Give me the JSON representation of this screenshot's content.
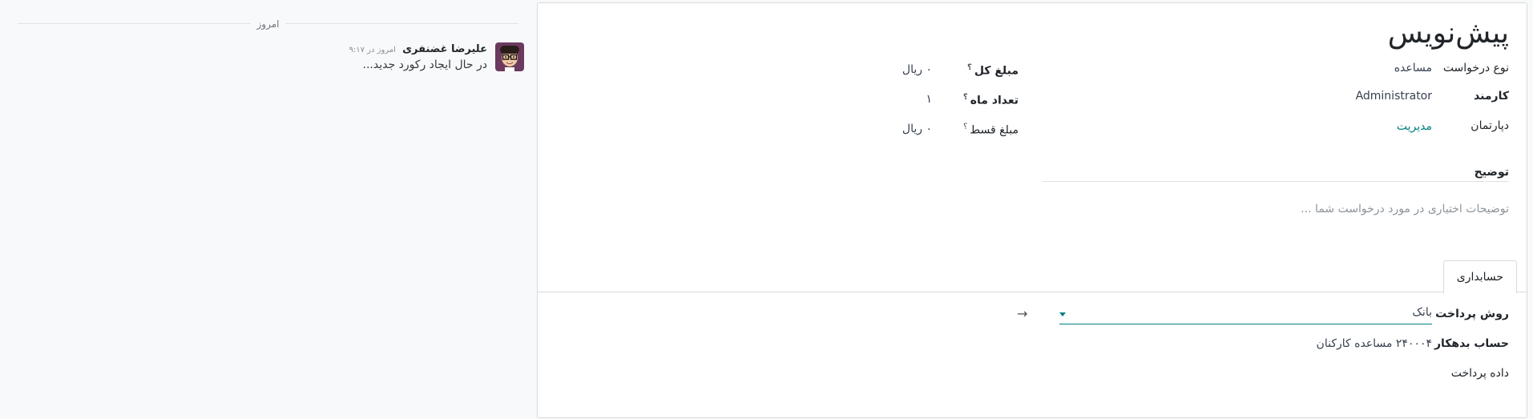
{
  "chatter": {
    "date_separator": "امروز",
    "message": {
      "author": "علیرضا غضنفری",
      "time": "امروز در ۹:۱۷",
      "body": "در حال ایجاد رکورد جدید..."
    }
  },
  "form": {
    "title": "پیش‌نویس",
    "request_type": {
      "label": "نوع درخواست",
      "value": "مساعده"
    },
    "employee": {
      "label": "کارمند",
      "value": "Administrator"
    },
    "department": {
      "label": "دپارتمان",
      "value": "مدیریت"
    },
    "total_amount": {
      "label": "مبلغ کل",
      "help": "؟",
      "value": "۰ ریال"
    },
    "months_count": {
      "label": "تعداد ماه",
      "help": "؟",
      "value": "۱"
    },
    "installment_amount": {
      "label": "مبلغ قسط",
      "help": "؟",
      "value": "۰ ریال"
    },
    "description": {
      "label": "توضیح",
      "placeholder": "توضیحات اختیاری در مورد درخواست شما ..."
    },
    "tabs": [
      {
        "label": "حسابداری"
      }
    ],
    "accounting": {
      "payment_method": {
        "label": "روش پرداخت",
        "value": "بانک"
      },
      "debit_account": {
        "label": "حساب بدهکار",
        "value": "۲۴۰۰۰۴ مساعده کارکنان"
      },
      "payment_data": {
        "label": "داده پرداخت"
      }
    }
  },
  "colors": {
    "accent": "#017e84",
    "border": "#d8dadd",
    "background": "#f8f9fa"
  }
}
